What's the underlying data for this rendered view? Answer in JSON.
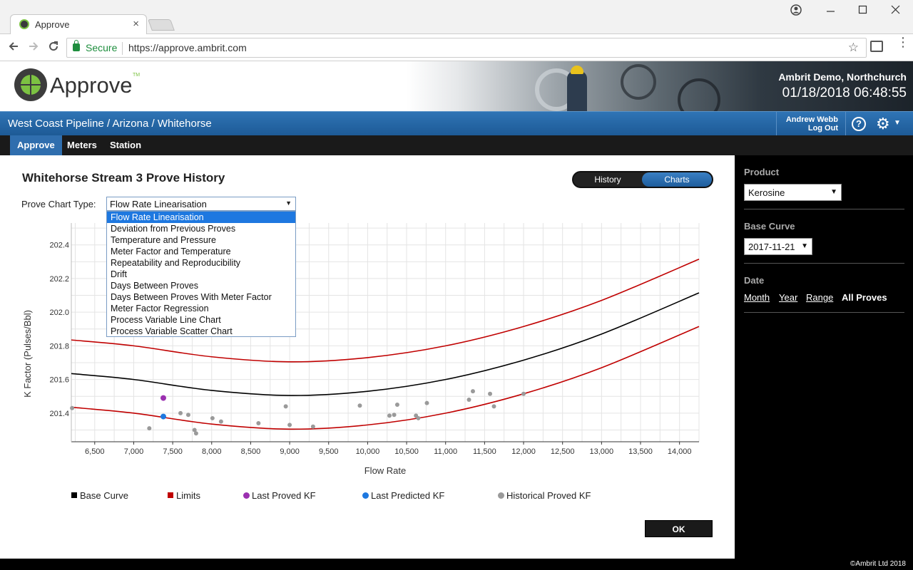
{
  "browser": {
    "tab_title": "Approve",
    "tab_close": "×",
    "secure_label": "Secure",
    "url": "https://approve.ambrit.com"
  },
  "header": {
    "logo_text": "Approve",
    "logo_tm": "TM",
    "site_name": "Ambrit Demo, Northchurch",
    "datetime": "01/18/2018 06:48:55"
  },
  "nav": {
    "breadcrumb": "West Coast Pipeline / Arizona / Whitehorse",
    "user_name": "Andrew Webb",
    "logout": "Log Out",
    "help": "?",
    "tabs": [
      "Approve",
      "Meters",
      "Station"
    ],
    "active_tab": "Approve"
  },
  "main": {
    "title": "Whitehorse Stream 3 Prove History",
    "toggle": {
      "history": "History",
      "charts": "Charts",
      "active": "Charts"
    },
    "chart_type_label": "Prove Chart Type:",
    "chart_type_value": "Flow Rate Linearisation",
    "chart_type_options": [
      "Flow Rate Linearisation",
      "Deviation from Previous Proves",
      "Temperature and Pressure",
      "Meter Factor and Temperature",
      "Repeatability and Reproducibility",
      "Drift",
      "Days Between Proves",
      "Days Between Proves With Meter Factor",
      "Meter Factor Regression",
      "Process Variable Line Chart",
      "Process Variable Scatter Chart"
    ],
    "ok_label": "OK"
  },
  "chart_data": {
    "type": "scatter",
    "xlabel": "Flow Rate",
    "ylabel": "K Factor (Pulses/Bbl)",
    "xlim": [
      6200,
      14250
    ],
    "ylim": [
      201.23,
      202.53
    ],
    "xticks": [
      6500,
      7000,
      7500,
      8000,
      8500,
      9000,
      9500,
      10000,
      10500,
      11000,
      11500,
      12000,
      12500,
      13000,
      13500,
      14000
    ],
    "xtick_labels": [
      "6,500",
      "7,000",
      "7,500",
      "8,000",
      "8,500",
      "9,000",
      "9,500",
      "10,000",
      "10,500",
      "11,000",
      "11,500",
      "12,000",
      "12,500",
      "13,000",
      "13,500",
      "14,000"
    ],
    "yticks": [
      201.4,
      201.6,
      201.8,
      202.0,
      202.2,
      202.4
    ],
    "ytick_labels": [
      "201.4",
      "201.6",
      "201.8",
      "202.0",
      "202.2",
      "202.4"
    ],
    "grid": true,
    "legend_position": "bottom",
    "series": [
      {
        "name": "Base Curve",
        "kind": "line",
        "color": "#000000",
        "x": [
          6200,
          7000,
          8000,
          9000,
          10000,
          11000,
          12000,
          13000,
          14250
        ],
        "values": [
          201.635,
          201.6,
          201.535,
          201.505,
          201.53,
          201.6,
          201.715,
          201.87,
          202.115
        ]
      },
      {
        "name": "Limits",
        "kind": "line",
        "color": "#c00000",
        "x": [
          6200,
          7000,
          8000,
          9000,
          10000,
          11000,
          12000,
          13000,
          14250
        ],
        "values": [
          201.835,
          201.8,
          201.735,
          201.705,
          201.73,
          201.8,
          201.915,
          202.07,
          202.315
        ]
      },
      {
        "name": "Limits",
        "kind": "line",
        "color": "#c00000",
        "x": [
          6200,
          7000,
          8000,
          9000,
          10000,
          11000,
          12000,
          13000,
          14250
        ],
        "values": [
          201.435,
          201.4,
          201.335,
          201.305,
          201.33,
          201.4,
          201.515,
          201.67,
          201.915
        ]
      },
      {
        "name": "Last Proved KF",
        "kind": "point",
        "color": "#9b30b0",
        "x": [
          7380
        ],
        "values": [
          201.49
        ]
      },
      {
        "name": "Last Predicted KF",
        "kind": "point",
        "color": "#1e78e0",
        "x": [
          7380
        ],
        "values": [
          201.38
        ]
      },
      {
        "name": "Historical Proved KF",
        "kind": "point",
        "color": "#9a9a9a",
        "x": [
          6210,
          7200,
          7600,
          7700,
          7780,
          7800,
          8010,
          8120,
          8600,
          8950,
          9000,
          9300,
          9900,
          10280,
          10340,
          10380,
          10620,
          10650,
          10760,
          11300,
          11350,
          11570,
          11620,
          12000
        ],
        "values": [
          201.43,
          201.31,
          201.4,
          201.39,
          201.3,
          201.28,
          201.37,
          201.35,
          201.34,
          201.44,
          201.33,
          201.32,
          201.445,
          201.385,
          201.39,
          201.45,
          201.385,
          201.37,
          201.46,
          201.48,
          201.53,
          201.515,
          201.44,
          201.515
        ]
      }
    ],
    "legend": [
      {
        "label": "Base Curve",
        "color": "#000000",
        "shape": "square"
      },
      {
        "label": "Limits",
        "color": "#c00000",
        "shape": "square"
      },
      {
        "label": "Last Proved KF",
        "color": "#9b30b0",
        "shape": "dot"
      },
      {
        "label": "Last Predicted KF",
        "color": "#1e78e0",
        "shape": "dot"
      },
      {
        "label": "Historical Proved KF",
        "color": "#9a9a9a",
        "shape": "dot"
      }
    ]
  },
  "sidebar": {
    "product_heading": "Product",
    "product_value": "Kerosine",
    "base_curve_heading": "Base Curve",
    "base_curve_value": "2017-11-21",
    "date_heading": "Date",
    "date_links": [
      "Month",
      "Year",
      "Range",
      "All Proves"
    ],
    "active_date_link": "All Proves"
  },
  "footer": {
    "copyright": "©Ambrit Ltd 2018"
  }
}
